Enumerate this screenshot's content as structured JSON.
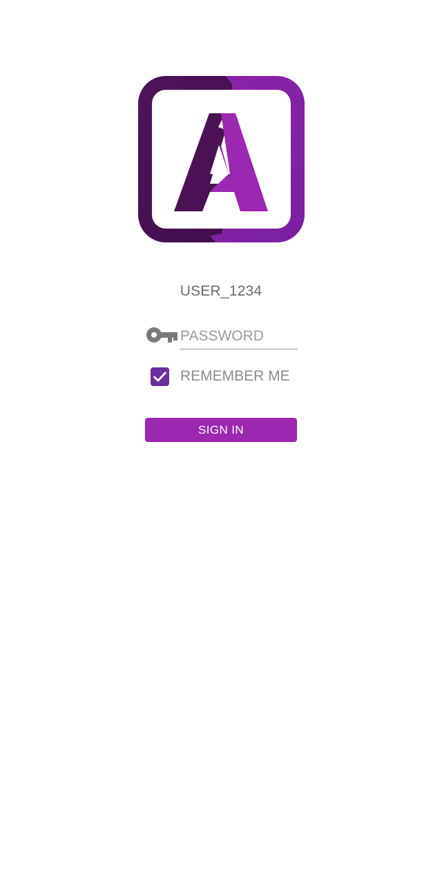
{
  "app": {
    "logo_letter": "A",
    "logo_colors": {
      "dark": "#4a1254",
      "light": "#9c27b0"
    }
  },
  "login": {
    "username": "USER_1234",
    "password_placeholder": "PASSWORD",
    "password_value": "",
    "remember_label": "REMEMBER ME",
    "remember_checked": true,
    "signin_label": "SIGN IN"
  },
  "icons": {
    "password": "key-icon",
    "remember": "check-icon"
  },
  "colors": {
    "accent": "#9c27b0",
    "checkbox": "#6a2fa0",
    "text_muted": "#8c8c8c"
  }
}
